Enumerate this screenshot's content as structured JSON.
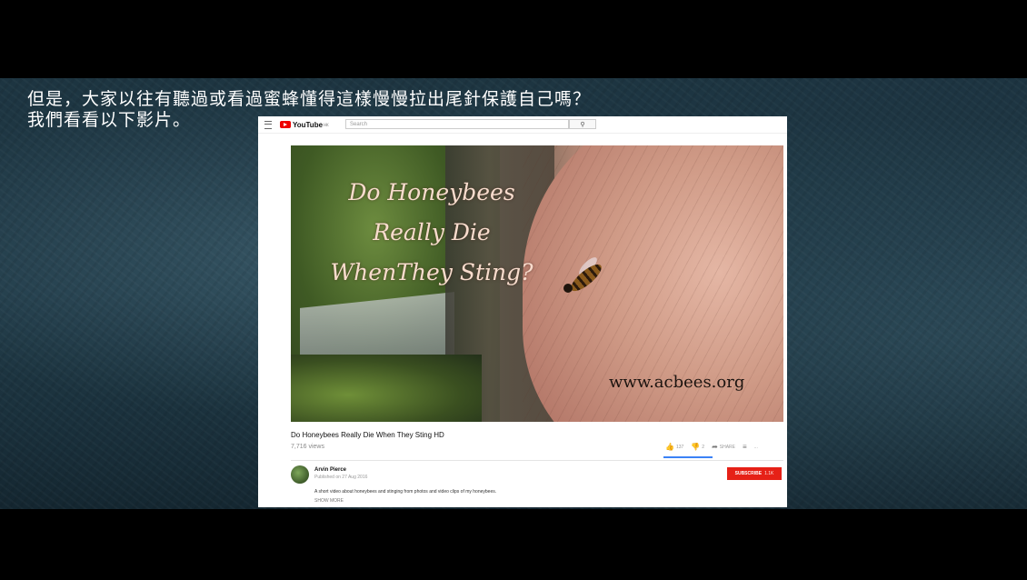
{
  "caption": {
    "line1": "但是，大家以往有聽過或看過蜜蜂懂得這樣慢慢拉出尾針保護自己嗎？",
    "line2": "我們看看以下影片。"
  },
  "youtube": {
    "logo_text": "YouTube",
    "logo_sup": "HK",
    "search_placeholder": "Search",
    "search_icon": "search-icon",
    "video": {
      "overlay_title": [
        "Do Honeybees",
        "Really Die",
        "WhenThey Sting?"
      ],
      "overlay_url": "www.acbees.org"
    },
    "title": "Do Honeybees Really Die When They Sting HD",
    "views": "7,716 views",
    "likes": "137",
    "dislikes": "2",
    "share_label": "SHARE",
    "more_label": "...",
    "channel": {
      "name": "Arvin Pierce",
      "published": "Published on 27 Aug 2016"
    },
    "subscribe": {
      "label": "SUBSCRIBE",
      "count": "1.1K"
    },
    "description": "A short video about honeybees and stinging from photos and video clips of my honeybees.",
    "show_more": "SHOW MORE"
  },
  "colors": {
    "subscribe_red": "#e62117",
    "youtube_red": "#ee0000",
    "like_bar": "#3b82f6"
  }
}
